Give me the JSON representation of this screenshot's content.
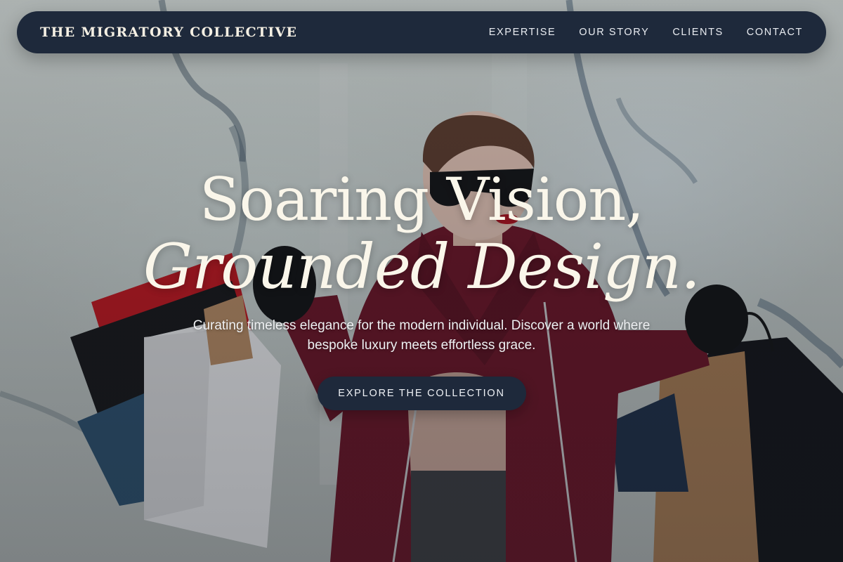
{
  "nav": {
    "brand": "THE MIGRATORY COLLECTIVE",
    "links": [
      "EXPERTISE",
      "OUR STORY",
      "CLIENTS",
      "CONTACT"
    ]
  },
  "hero": {
    "headline_line1": "Soaring Vision,",
    "headline_line2": "Grounded Design.",
    "subtitle": "Curating timeless elegance for the modern individual. Discover a world where bespoke luxury meets effortless grace.",
    "cta_label": "EXPLORE THE COLLECTION",
    "background_image": "woman-with-shopping-bags-photo"
  },
  "colors": {
    "nav_bg": "#1e293b",
    "cta_bg": "#1e293b",
    "headline": "#faf6ea",
    "brand_text": "#f4efe3"
  }
}
